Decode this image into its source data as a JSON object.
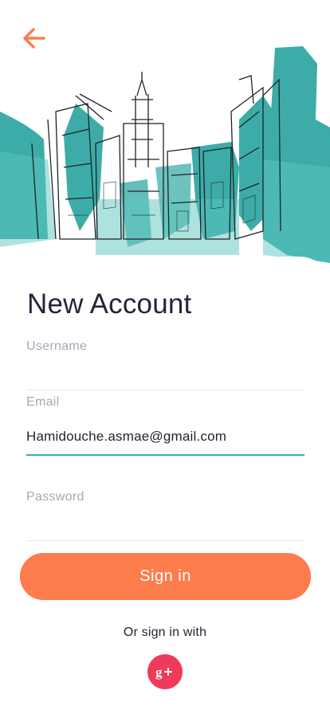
{
  "header": {
    "back_icon": "arrow-left-icon",
    "illustration": "city-sketch-watercolor"
  },
  "form": {
    "title": "New Account",
    "username": {
      "label": "Username",
      "value": ""
    },
    "email": {
      "label": "Email",
      "value": "Hamidouche.asmae@gmail.com"
    },
    "password": {
      "label": "Password",
      "value": ""
    }
  },
  "actions": {
    "signin_label": "Sign in",
    "alt_label": "Or sign in with",
    "google_icon": "google-plus-icon"
  },
  "colors": {
    "accent": "#fd7c4c",
    "teal": "#1a9e99",
    "input_focus": "#2fb3a8",
    "google": "#f03a5a"
  }
}
